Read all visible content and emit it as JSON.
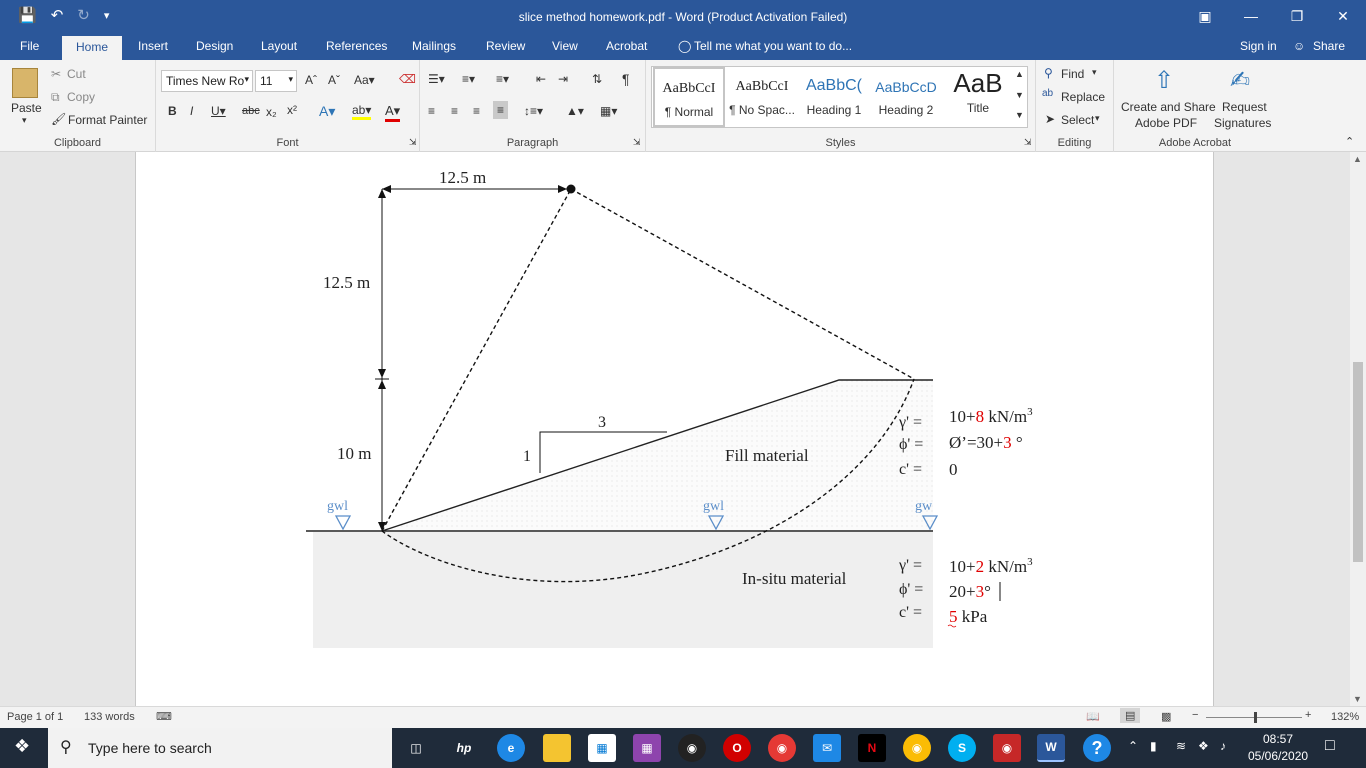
{
  "window": {
    "title": "slice method homework.pdf - Word (Product Activation Failed)"
  },
  "ribbon_tabs": [
    "File",
    "Home",
    "Insert",
    "Design",
    "Layout",
    "References",
    "Mailings",
    "Review",
    "View",
    "Acrobat"
  ],
  "tell_me": "Tell me what you want to do...",
  "account": {
    "sign_in": "Sign in",
    "share": "Share"
  },
  "clipboard": {
    "paste": "Paste",
    "cut": "Cut",
    "copy": "Copy",
    "format_painter": "Format Painter",
    "label": "Clipboard"
  },
  "font": {
    "name": "Times New Ro",
    "size": "11",
    "label": "Font"
  },
  "paragraph": {
    "label": "Paragraph"
  },
  "styles": {
    "items": [
      {
        "preview": "AaBbCcI",
        "name": "¶ Normal"
      },
      {
        "preview": "AaBbCcI",
        "name": "¶ No Spac..."
      },
      {
        "preview": "AaBbC(",
        "name": "Heading 1"
      },
      {
        "preview": "AaBbCcD",
        "name": "Heading 2"
      },
      {
        "preview": "AaB",
        "name": "Title"
      }
    ],
    "label": "Styles"
  },
  "editing": {
    "find": "Find",
    "replace": "Replace",
    "select": "Select",
    "label": "Editing"
  },
  "acrobat": {
    "create_share_1": "Create and Share",
    "create_share_2": "Adobe PDF",
    "request_1": "Request",
    "request_2": "Signatures",
    "label": "Adobe Acrobat"
  },
  "figure": {
    "dim_top": "12.5 m",
    "dim_left_upper": "12.5 m",
    "dim_left_lower": "10 m",
    "slope_run": "3",
    "slope_rise": "1",
    "fill_label": "Fill material",
    "insitu_label": "In-situ material",
    "gwl": "gwl",
    "gwl_cut": "gw",
    "fill_props": {
      "gamma_sym": "γ' =",
      "phi_sym": "ϕ' =",
      "c_sym": "c' =",
      "gamma_base": "10+",
      "gamma_add": "8",
      "gamma_unit": " kN/m",
      "unit_sup": "3",
      "phi_base": "Ø’=30+",
      "phi_add": "3",
      "phi_unit": " °",
      "c_val": "0"
    },
    "insitu_props": {
      "gamma_sym": "γ' =",
      "phi_sym": "ϕ' =",
      "c_sym": "c' =",
      "gamma_base": "10+",
      "gamma_add": "2",
      "gamma_unit": " kN/m",
      "unit_sup": "3",
      "phi_base": "20+",
      "phi_add": "3",
      "phi_unit": "°",
      "c_add": "5",
      "c_unit": " kPa"
    }
  },
  "status": {
    "page": "Page 1 of 1",
    "words": "133 words",
    "zoom": "132%"
  },
  "taskbar": {
    "search": "Type here to search",
    "time": "08:57",
    "date": "05/06/2020"
  },
  "colors": {
    "word_blue": "#2b579a",
    "accent_red": "#e00000"
  }
}
